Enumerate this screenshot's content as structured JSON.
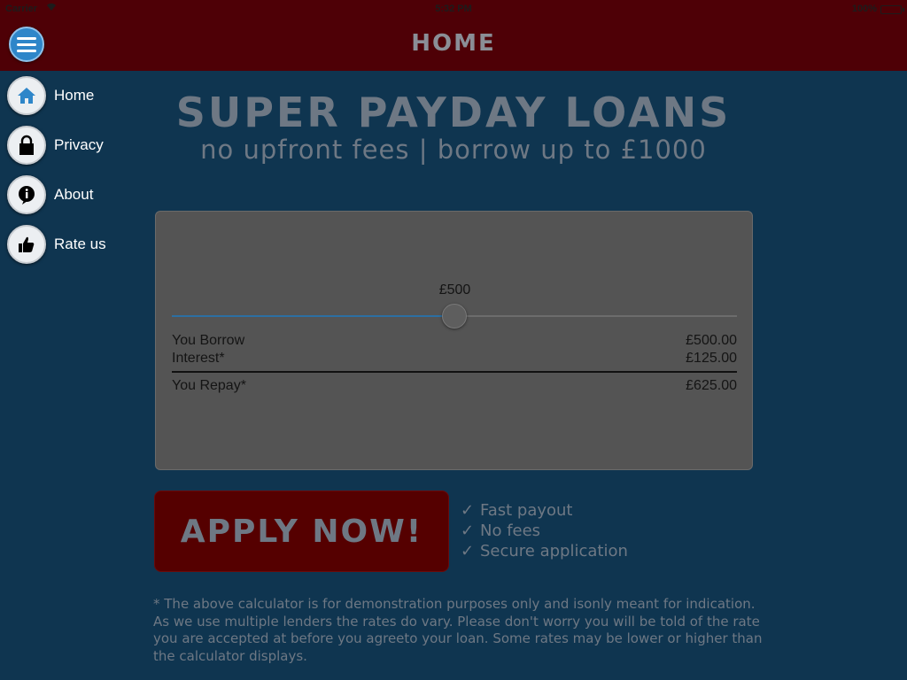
{
  "status_bar": {
    "carrier": "Carrier",
    "wifi_icon": "wifi-icon",
    "time": "5:32 PM",
    "battery": "100%"
  },
  "nav": {
    "title": "HOME",
    "menu_icon": "hamburger-menu-icon"
  },
  "sidebar": {
    "items": [
      {
        "label": "Home",
        "icon": "home-icon",
        "icon_color": "#2e86c9"
      },
      {
        "label": "Privacy",
        "icon": "lock-icon",
        "icon_color": "#000000"
      },
      {
        "label": "About",
        "icon": "info-icon",
        "icon_color": "#000000"
      },
      {
        "label": "Rate us",
        "icon": "thumbs-up-icon",
        "icon_color": "#000000"
      }
    ]
  },
  "main": {
    "headline": "SUPER PAYDAY LOANS",
    "subline": "no upfront fees | borrow up to £1000",
    "calculator": {
      "amount_display": "£500",
      "slider": {
        "min": 0,
        "max": 1000,
        "value": 500,
        "fraction": 0.5
      },
      "borrow_label": "You Borrow",
      "borrow_value": "£500.00",
      "interest_label": "Interest*",
      "interest_value": "£125.00",
      "repay_label": "You Repay*",
      "repay_value": "£625.00"
    },
    "apply_button": "APPLY NOW!",
    "benefits": [
      {
        "tick": "✓",
        "text": "Fast payout"
      },
      {
        "tick": "✓",
        "text": "No fees"
      },
      {
        "tick": "✓",
        "text": "Secure application"
      }
    ],
    "disclaimer": "* The above calculator is for demonstration purposes only and isonly meant for indication. As we use multiple lenders the rates do vary. Please don't worry you will be told of the rate you are accepted at before you agreeto your loan. Some rates may be lower or higher than the calculator displays."
  },
  "colors": {
    "background": "#0f3550",
    "top_bar": "#4e0006",
    "accent": "#2e86c9",
    "panel": "#545454",
    "apply_button": "#550000",
    "muted_text": "#6e7884"
  }
}
